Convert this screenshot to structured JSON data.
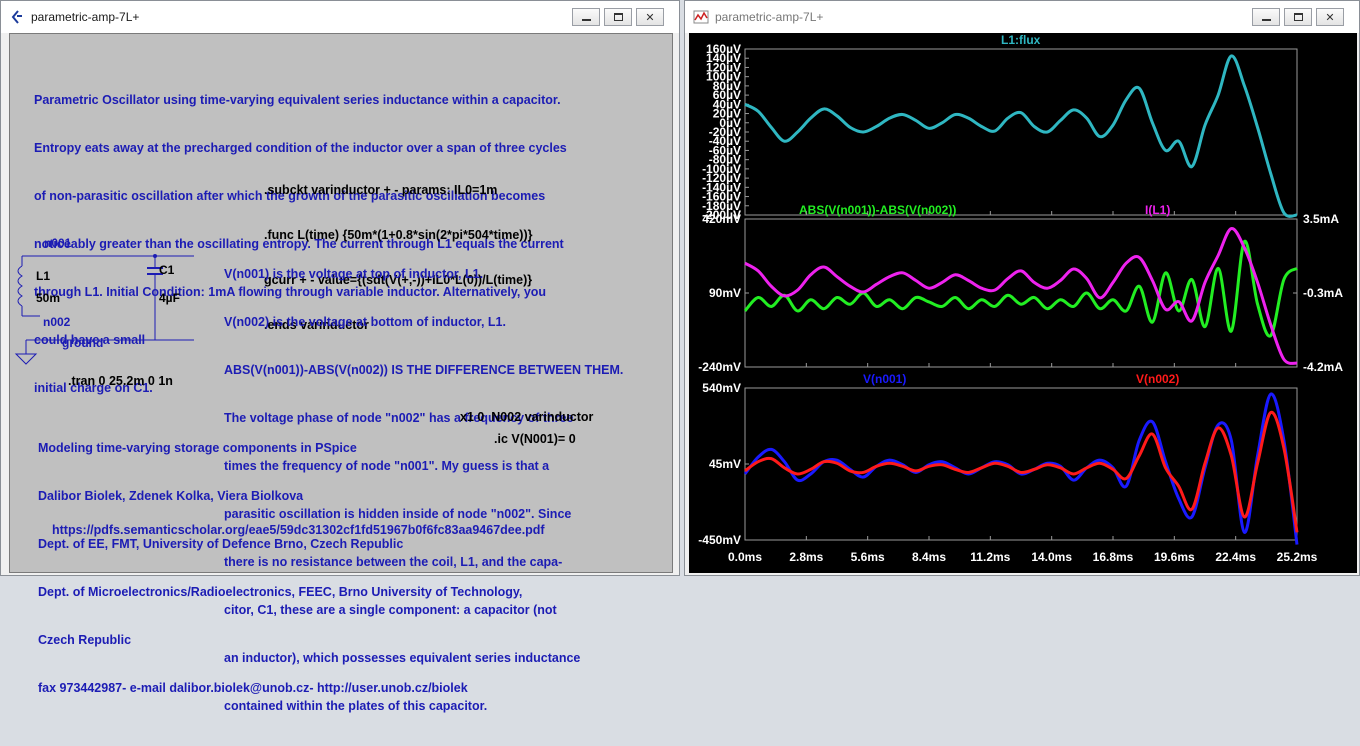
{
  "schematic": {
    "title": "parametric-amp-7L+",
    "description_lines": [
      "Parametric Oscillator using time-varying equivalent series inductance within a capacitor.",
      "Entropy eats away at the precharged condition of the inductor over a span of three cycles",
      "of non-parasitic oscillation after which the growth of the parasitic oscillation becomes",
      "noticeably greater than the oscillating entropy. The current through L1 equals the current",
      "through L1. Initial Condition: 1mA flowing through variable inductor. Alternatively, you",
      "could have a small",
      "initial charge on C1."
    ],
    "subckt_lines": [
      ".subckt varinductor + - params: IL0=1m",
      ".func L(time) {50m*(1+0.8*sin(2*pi*504*time))}",
      "gcurr + - value={(sdt(V(+,-))+IL0*L(0))/L(time)}",
      ".ends varinductor"
    ],
    "explanation_lines": [
      "V(n001) is the voltage at top of inductor, L1.",
      "V(n002) is the voltage at bottom of inductor, L1.",
      "ABS(V(n001))-ABS(V(n002)) IS THE DIFFERENCE BETWEEN THEM.",
      "The voltage phase of node \"n002\" has a frequency of three",
      "times the frequency of node \"n001\". My guess is that a",
      "parasitic oscillation is hidden inside of node \"n002\". Since",
      "there is no resistance between the coil, L1, and the capa-",
      "citor, C1, these are a single component: a capacitor (not",
      "an inductor), which possesses equivalent series inductance",
      "contained within the plates of this capacitor."
    ],
    "credits_lines": [
      "Modeling time-varying storage components in PSpice",
      "Dalibor Biolek, Zdenek Kolka, Viera Biolkova",
      "Dept. of EE, FMT, University of Defence Brno, Czech Republic",
      "Dept. of Microelectronics/Radioelectronics, FEEC, Brno University of Technology,",
      "Czech Republic",
      "fax 973442987- e-mail dalibor.biolek@unob.cz- http://user.unob.cz/biolek"
    ],
    "url": "https://pdfs.semanticscholar.org/eae5/59dc31302cf1fd51967b0f6fc83aa9467dee.pdf",
    "tran": ".tran 0 25.2m 0 1n",
    "x1": "x1 0  N002 varinductor",
    "ic": ".ic V(N001)= 0",
    "labels": {
      "n001": "n001",
      "n002": "n002",
      "ground": "ground",
      "l1": "L1",
      "l1_value": "50m",
      "c1": "C1",
      "c1_value": "4µF"
    }
  },
  "waveform": {
    "title": "parametric-amp-7L+",
    "x_ticks": [
      "0.0ms",
      "2.8ms",
      "5.6ms",
      "8.4ms",
      "11.2ms",
      "14.0ms",
      "16.8ms",
      "19.6ms",
      "22.4ms",
      "25.2ms"
    ],
    "pane1": {
      "trace_label": "L1:flux",
      "trace_color": "#2fb7c2",
      "y_ticks": [
        "160µV",
        "140µV",
        "120µV",
        "100µV",
        "80µV",
        "60µV",
        "40µV",
        "20µV",
        "0µV",
        "-20µV",
        "-40µV",
        "-60µV",
        "-80µV",
        "-100µV",
        "-120µV",
        "-140µV",
        "-160µV",
        "-180µV",
        "-200µV"
      ]
    },
    "pane2": {
      "trace1_label": "ABS(V(n001))-ABS(V(n002))",
      "trace1_color": "#22ee22",
      "trace2_label": "I(L1)",
      "trace2_color": "#ee22ee",
      "y_ticks_left": [
        "420mV",
        "90mV",
        "-240mV"
      ],
      "y_ticks_right": [
        "3.5mA",
        "-0.3mA",
        "-4.2mA"
      ]
    },
    "pane3": {
      "trace1_label": "V(n001)",
      "trace1_color": "#1a1aff",
      "trace2_label": "V(n002)",
      "trace2_color": "#ff1a1a",
      "y_ticks": [
        "540mV",
        "45mV",
        "-450mV"
      ]
    }
  },
  "chart_data": [
    {
      "type": "line",
      "title": "L1:flux",
      "x": [
        0,
        0.6,
        1.2,
        1.8,
        2.4,
        3.0,
        3.6,
        4.2,
        4.8,
        5.4,
        6.0,
        6.6,
        7.2,
        7.8,
        8.4,
        9.0,
        9.6,
        10.2,
        10.8,
        11.4,
        12.0,
        12.6,
        13.2,
        13.8,
        14.4,
        15.0,
        15.6,
        16.2,
        16.8,
        17.4,
        18.0,
        18.6,
        19.2,
        19.8,
        20.4,
        21.0,
        21.6,
        22.2,
        22.8,
        23.4,
        24.0,
        24.6,
        25.2
      ],
      "series": [
        {
          "name": "L1:flux",
          "values": [
            40,
            25,
            -10,
            -40,
            -20,
            10,
            30,
            15,
            -10,
            -20,
            -8,
            10,
            18,
            5,
            -12,
            0,
            18,
            10,
            -8,
            -18,
            10,
            22,
            -8,
            -20,
            5,
            28,
            10,
            -30,
            -5,
            50,
            75,
            0,
            -60,
            -40,
            -95,
            -5,
            60,
            145,
            80,
            -10,
            -110,
            -195,
            -200
          ]
        }
      ],
      "xlim": [
        0,
        25.2
      ],
      "ylim": [
        -200,
        160
      ]
    },
    {
      "type": "line",
      "x": [
        0,
        0.6,
        1.2,
        1.8,
        2.4,
        3.0,
        3.6,
        4.2,
        4.8,
        5.4,
        6.0,
        6.6,
        7.2,
        7.8,
        8.4,
        9.0,
        9.6,
        10.2,
        10.8,
        11.4,
        12.0,
        12.6,
        13.2,
        13.8,
        14.4,
        15.0,
        15.6,
        16.2,
        16.8,
        17.4,
        18.0,
        18.6,
        19.2,
        19.8,
        20.4,
        21.0,
        21.6,
        22.2,
        22.8,
        23.4,
        24.0,
        24.6,
        25.2
      ],
      "series": [
        {
          "name": "ABS(V(n001))-ABS(V(n002))",
          "values": [
            10,
            70,
            30,
            80,
            10,
            60,
            20,
            70,
            40,
            90,
            30,
            60,
            20,
            70,
            50,
            30,
            70,
            20,
            60,
            30,
            80,
            40,
            70,
            20,
            60,
            30,
            90,
            20,
            60,
            10,
            120,
            -40,
            180,
            10,
            150,
            -60,
            200,
            -80,
            320,
            40,
            -100,
            150,
            200
          ]
        },
        {
          "name": "I(L1)",
          "values": [
            1.2,
            0.8,
            0.0,
            -0.5,
            -0.2,
            0.6,
            1.0,
            0.5,
            0.0,
            -0.3,
            0.1,
            0.5,
            0.7,
            0.3,
            -0.1,
            0.2,
            0.6,
            0.3,
            -0.1,
            -0.2,
            0.4,
            0.8,
            0.2,
            -0.1,
            0.3,
            0.9,
            0.4,
            -0.6,
            0.2,
            1.2,
            1.5,
            0.3,
            -1.2,
            -0.8,
            -1.8,
            0.2,
            1.6,
            3.0,
            2.0,
            0.2,
            -2.0,
            -3.8,
            -4.0
          ]
        }
      ],
      "xlim": [
        0,
        25.2
      ],
      "ylim_left": [
        -240,
        420
      ],
      "ylim_right": [
        -4.2,
        3.5
      ]
    },
    {
      "type": "line",
      "x": [
        0,
        0.6,
        1.2,
        1.8,
        2.4,
        3.0,
        3.6,
        4.2,
        4.8,
        5.4,
        6.0,
        6.6,
        7.2,
        7.8,
        8.4,
        9.0,
        9.6,
        10.2,
        10.8,
        11.4,
        12.0,
        12.6,
        13.2,
        13.8,
        14.4,
        15.0,
        15.6,
        16.2,
        16.8,
        17.4,
        18.0,
        18.6,
        19.2,
        19.8,
        20.4,
        21.0,
        21.6,
        22.2,
        22.8,
        23.4,
        24.0,
        24.6,
        25.2
      ],
      "series": [
        {
          "name": "V(n001)",
          "values": [
            -20,
            90,
            140,
            60,
            -60,
            -20,
            60,
            70,
            10,
            -40,
            30,
            70,
            40,
            -10,
            40,
            60,
            20,
            -20,
            20,
            60,
            40,
            -20,
            10,
            50,
            30,
            -60,
            20,
            70,
            20,
            -100,
            200,
            320,
            60,
            -180,
            -300,
            20,
            300,
            200,
            -400,
            100,
            500,
            200,
            -480
          ]
        },
        {
          "name": "V(n002)",
          "values": [
            0,
            60,
            80,
            20,
            -20,
            10,
            60,
            50,
            0,
            -10,
            30,
            50,
            30,
            0,
            30,
            40,
            10,
            -10,
            20,
            50,
            30,
            -10,
            10,
            40,
            20,
            -20,
            20,
            50,
            10,
            -50,
            100,
            240,
            20,
            -100,
            -250,
            50,
            280,
            100,
            -300,
            50,
            380,
            150,
            -400
          ]
        }
      ],
      "xlim": [
        0,
        25.2
      ],
      "ylim": [
        -450,
        540
      ]
    }
  ]
}
